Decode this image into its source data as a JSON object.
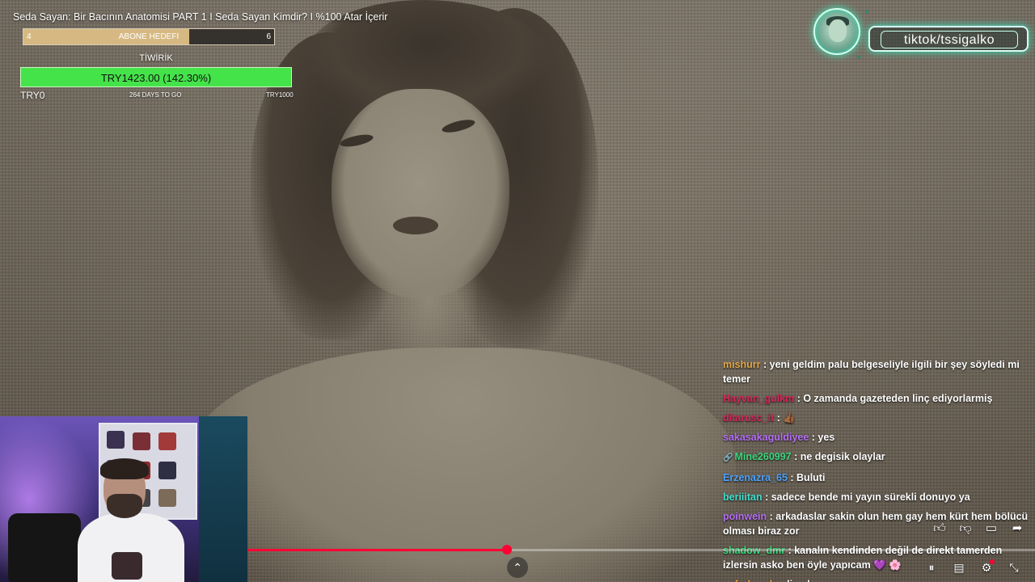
{
  "video": {
    "title": "Seda Sayan: Bir Bacının Anatomisi PART 1 I Seda Sayan Kimdir? I %100 Atar İçerir",
    "progress_fraction": 0.33
  },
  "sub_goal": {
    "label": "ABONE HEDEFI",
    "current": "4",
    "target": "6",
    "fill_fraction": 0.66
  },
  "tip_goal": {
    "title": "TİWİRİK",
    "amount_text": "TRY1423.00 (142.30%)",
    "min_label": "TRY0",
    "days_label": "264 DAYS TO GO",
    "max_label": "TRY1000",
    "fill_fraction": 1.0
  },
  "tiktok": {
    "label": "tiktok/tssigalko"
  },
  "chat": {
    "messages": [
      {
        "user": "mishurr",
        "user_color": "#e3a94b",
        "text": " : yeni geldim palu belgeseliyle ilgili bir şey söyledi mi temer"
      },
      {
        "user": "Hayvan_gulkm",
        "user_color": "#d8265c",
        "text": " : O zamanda gazeteden linç ediyorlarmiş"
      },
      {
        "user": "ditarusc_it",
        "user_color": "#d8265c",
        "text": " : 👍🏾"
      },
      {
        "user": "sakasakaguldiyee",
        "user_color": "#b56ff5",
        "text": " : yes"
      },
      {
        "user": "Mine260997",
        "user_color": "#3ad87c",
        "badge": "🔗",
        "text": " : ne degisik olaylar"
      },
      {
        "user": "Erzenazra_65",
        "user_color": "#4da3ff",
        "text": " : Buluti"
      },
      {
        "user": "beriiitan",
        "user_color": "#3ee0d0",
        "text": " : sadece bende mi yayın sürekli donuyo ya"
      },
      {
        "user": "poinwein",
        "user_color": "#b56ff5",
        "text": " : arkadaslar sakin olun hem gay hem kürt hem bölücü olması biraz zor"
      },
      {
        "user": "shadow_dmr",
        "user_color": "#3ad87c",
        "text": " : kanalın kendinden değil de direkt tamerden izlersin asko ben öyle yapıcam 💜 🌸"
      },
      {
        "user": "naferhunde",
        "user_color": "#f0a23a",
        "text": " : linç her zaman"
      }
    ]
  },
  "controls": {
    "expand_icon": "chevron-up-icon",
    "like_icon": "thumbs-up-icon",
    "dislike_icon": "thumbs-down-icon",
    "comment_icon": "comment-icon",
    "share_icon": "share-icon",
    "pause_icon": "pause-icon",
    "captions_icon": "captions-icon",
    "settings_icon": "settings-icon",
    "minimize_icon": "minimize-icon"
  }
}
